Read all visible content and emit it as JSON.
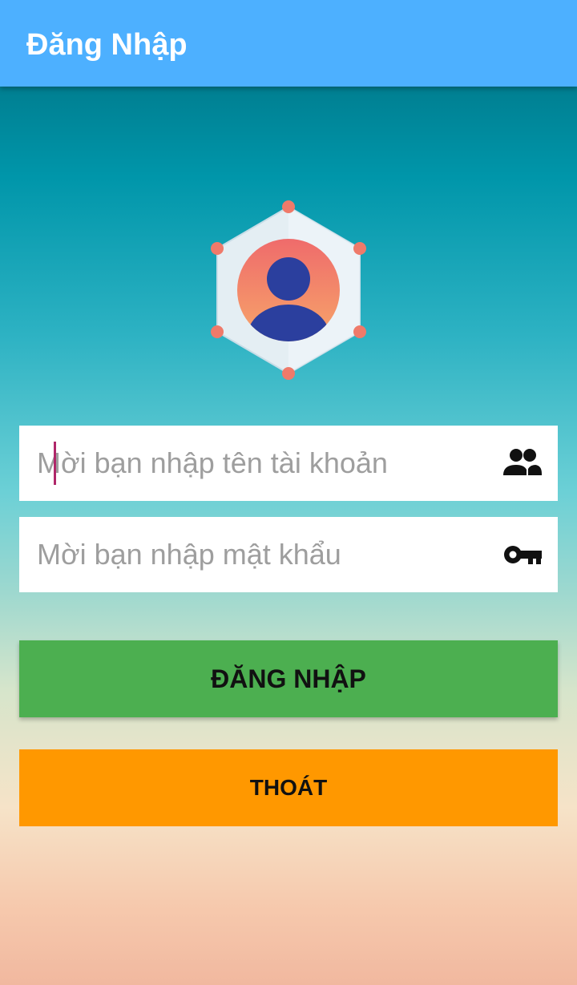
{
  "app_bar": {
    "title": "Đăng Nhập",
    "color": "#4db0ff"
  },
  "logo": {
    "icon": "user-avatar-hexagon-icon"
  },
  "form": {
    "username": {
      "value": "",
      "placeholder": "Mời bạn nhập tên tài khoản",
      "icon": "people-icon"
    },
    "password": {
      "value": "",
      "placeholder": "Mời bạn nhập mật khẩu",
      "icon": "key-icon"
    }
  },
  "buttons": {
    "login_label": "ĐĂNG NHẬP",
    "login_color": "#4caf50",
    "exit_label": "THOÁT",
    "exit_color": "#ff9800"
  }
}
